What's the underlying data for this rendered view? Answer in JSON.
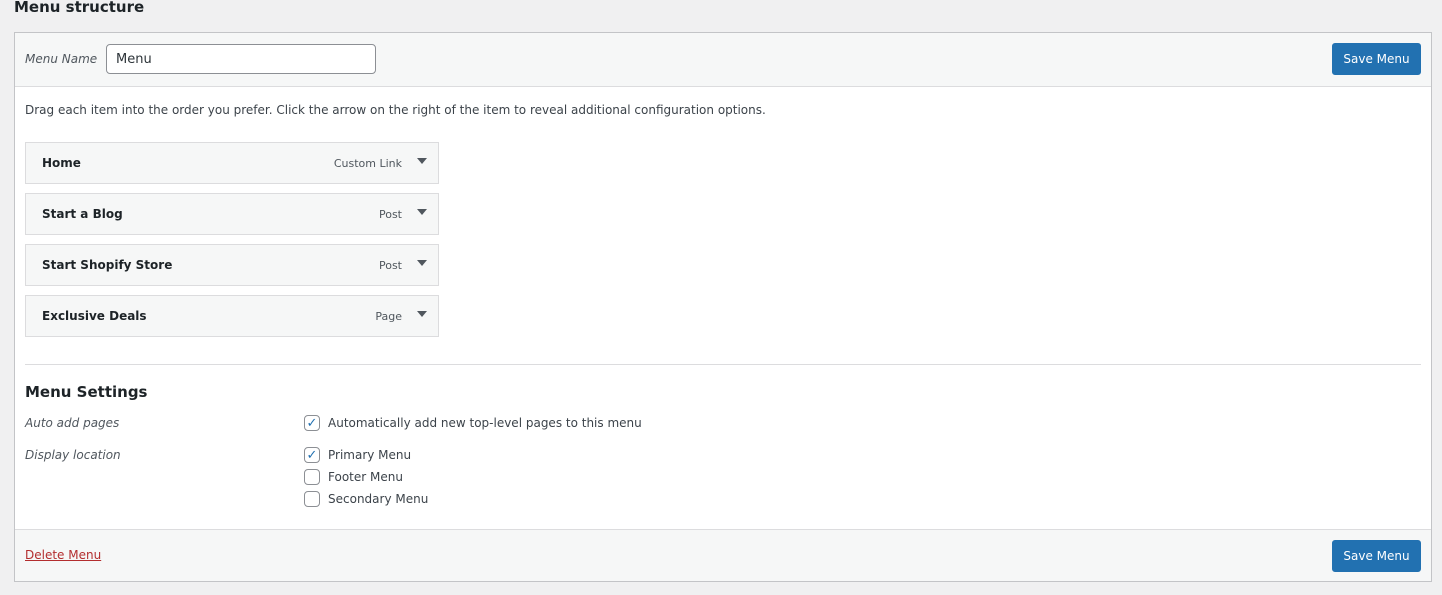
{
  "title": "Menu structure",
  "menu_name": {
    "label": "Menu Name",
    "value": "Menu"
  },
  "save_label": "Save Menu",
  "instructions": "Drag each item into the order you prefer. Click the arrow on the right of the item to reveal additional configuration options.",
  "items": [
    {
      "title": "Home",
      "type": "Custom Link"
    },
    {
      "title": "Start a Blog",
      "type": "Post"
    },
    {
      "title": "Start Shopify Store",
      "type": "Post"
    },
    {
      "title": "Exclusive Deals",
      "type": "Page"
    }
  ],
  "settings": {
    "heading": "Menu Settings",
    "auto_add": {
      "label": "Auto add pages",
      "option": "Automatically add new top-level pages to this menu",
      "checked": true
    },
    "display": {
      "label": "Display location",
      "options": [
        {
          "label": "Primary Menu",
          "checked": true
        },
        {
          "label": "Footer Menu",
          "checked": false
        },
        {
          "label": "Secondary Menu",
          "checked": false
        }
      ]
    }
  },
  "delete_label": "Delete Menu",
  "colors": {
    "accent": "#2271b1",
    "danger": "#b32d2e"
  }
}
